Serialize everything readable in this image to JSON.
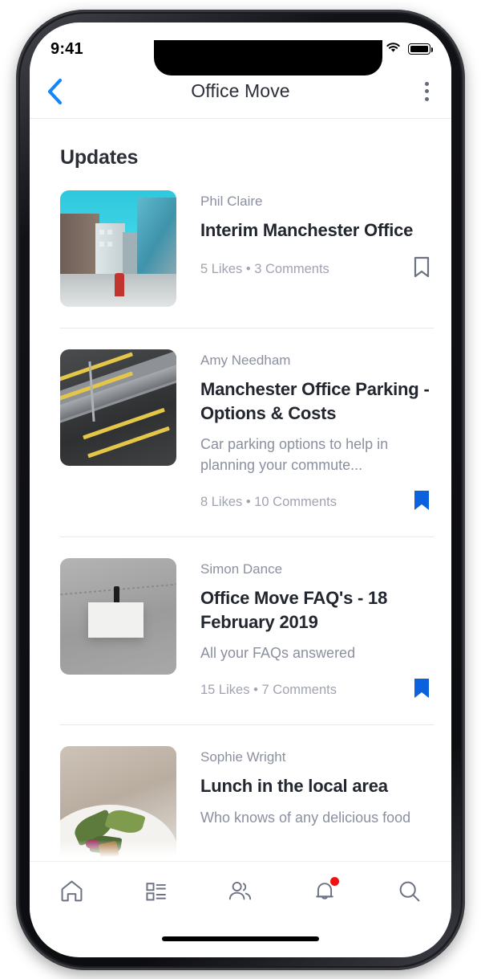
{
  "status_bar": {
    "time": "9:41",
    "signal_icon": "cellular-signal-icon",
    "wifi_icon": "wifi-icon",
    "battery_icon": "battery-full-icon"
  },
  "header": {
    "title": "Office Move",
    "back_icon": "chevron-left-icon",
    "more_icon": "more-vertical-icon",
    "back_color": "#1485fa"
  },
  "feed": {
    "section_title": "Updates",
    "posts": [
      {
        "author": "Phil Claire",
        "title": "Interim Manchester Office",
        "excerpt": "",
        "likes": "5 Likes",
        "separator": "•",
        "comments": "3 Comments",
        "bookmarked": false,
        "thumb": "manchester-street-photo"
      },
      {
        "author": "Amy Needham",
        "title": "Manchester Office Parking - Options & Costs",
        "excerpt": "Car parking options to help in planning your commute...",
        "likes": "8 Likes",
        "separator": "•",
        "comments": "10 Comments",
        "bookmarked": true,
        "thumb": "car-park-photo"
      },
      {
        "author": "Simon Dance",
        "title": "Office Move FAQ's - 18 February 2019",
        "excerpt": "All your FAQs answered",
        "likes": "15 Likes",
        "separator": "•",
        "comments": "7 Comments",
        "bookmarked": true,
        "thumb": "hanging-note-photo"
      },
      {
        "author": "Sophie Wright",
        "title": "Lunch in the local area",
        "excerpt": "Who knows of any delicious food",
        "likes": "",
        "separator": "",
        "comments": "",
        "bookmarked": false,
        "thumb": "salad-plate-photo"
      }
    ]
  },
  "bottom_nav": {
    "items": [
      {
        "icon": "home-icon",
        "badge": false
      },
      {
        "icon": "dashboard-list-icon",
        "badge": false
      },
      {
        "icon": "people-icon",
        "badge": false
      },
      {
        "icon": "bell-icon",
        "badge": true
      },
      {
        "icon": "search-icon",
        "badge": false
      }
    ],
    "badge_color": "#f01212"
  },
  "colors": {
    "accent_blue": "#0b62dc",
    "link_blue": "#1485fa",
    "text_dark": "#22262e",
    "text_muted": "#8b90a0",
    "divider": "#e9e9eb"
  }
}
